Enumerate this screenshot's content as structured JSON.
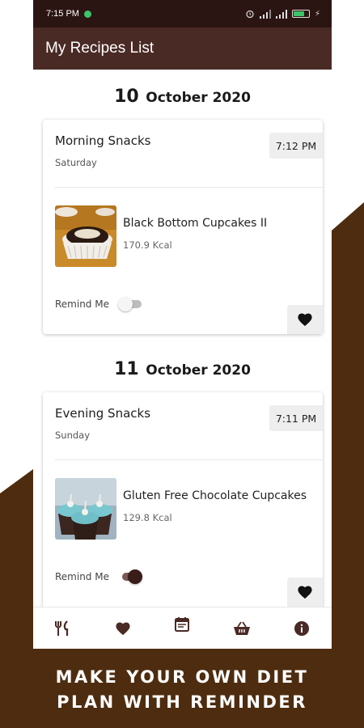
{
  "status_bar": {
    "time": "7:15 PM"
  },
  "app_bar": {
    "title": "My Recipes List"
  },
  "colors": {
    "brand_dark": "#4a2a25",
    "status_bar": "#2b1512",
    "background_shape": "#4e2c0f",
    "accent": "#3a1c18"
  },
  "entries": [
    {
      "day": "10",
      "month_year": "October 2020",
      "meal": "Morning Snacks",
      "weekday": "Saturday",
      "time": "7:12 PM",
      "recipe_name": "Black Bottom Cupcakes II",
      "calories": "170.9 Kcal",
      "remind_label": "Remind Me",
      "remind_on": false,
      "favorite_icon": "heart-icon"
    },
    {
      "day": "11",
      "month_year": "October 2020",
      "meal": "Evening Snacks",
      "weekday": "Sunday",
      "time": "7:11 PM",
      "recipe_name": "Gluten Free Chocolate Cupcakes",
      "calories": "129.8 Kcal",
      "remind_label": "Remind Me",
      "remind_on": true,
      "favorite_icon": "heart-icon"
    }
  ],
  "bottom_nav": [
    {
      "icon": "fork-knife-icon"
    },
    {
      "icon": "heart-icon"
    },
    {
      "icon": "calendar-icon",
      "active": true
    },
    {
      "icon": "basket-icon"
    },
    {
      "icon": "info-icon"
    }
  ],
  "promo": {
    "line1": "MAKE YOUR OWN DIET",
    "line2": "PLAN WITH REMINDER"
  }
}
